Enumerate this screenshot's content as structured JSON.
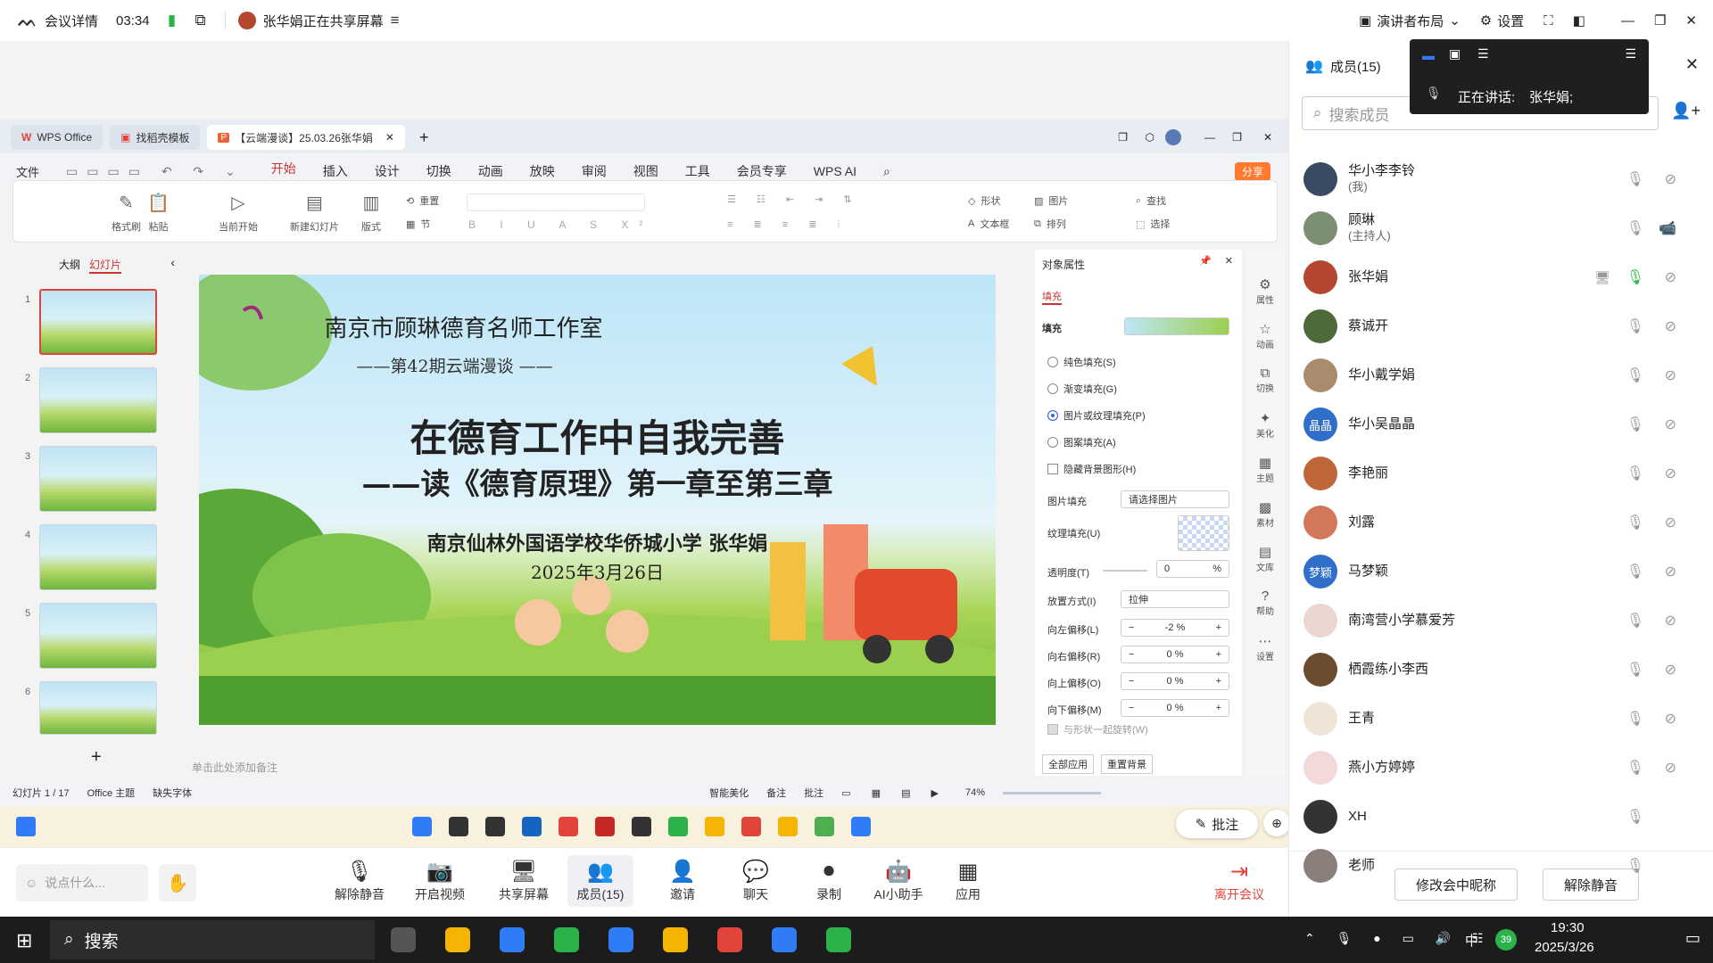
{
  "meeting": {
    "details_label": "会议详情",
    "timer": "03:34",
    "sharing_status": "张华娟正在共享屏幕",
    "layout_label": "演讲者布局",
    "settings_label": "设置"
  },
  "wps": {
    "tabs": [
      "WPS Office",
      "找稻壳模板",
      "【云端漫谈】25.03.26张华娟"
    ],
    "menu": [
      "文件",
      "开始",
      "插入",
      "设计",
      "切换",
      "动画",
      "放映",
      "审阅",
      "视图",
      "工具",
      "会员专享",
      "WPS AI"
    ],
    "share_label": "分享",
    "ribbon": {
      "format_painter": "格式刷",
      "paste": "粘贴",
      "from_start": "当前开始",
      "new_slide": "新建幻灯片",
      "layout": "版式",
      "reset": "重置",
      "section": "节",
      "shape": "形状",
      "picture": "图片",
      "textbox": "文本框",
      "arrange": "排列",
      "find": "查找",
      "select": "选择"
    },
    "pane_tabs": [
      "大纲",
      "幻灯片"
    ],
    "slide_numbers": [
      "1",
      "2",
      "3",
      "4",
      "5",
      "6"
    ],
    "notes_placeholder": "单击此处添加备注",
    "status": {
      "slide_count": "幻灯片 1 / 17",
      "theme": "Office 主题",
      "missing_font": "缺失字体",
      "smart": "智能美化",
      "notes": "备注",
      "comment": "批注",
      "zoom": "74%"
    }
  },
  "slide": {
    "studio": "南京市顾琳德育名师工作室",
    "issue": "——第42期云端漫谈 ——",
    "title": "在德育工作中自我完善",
    "subtitle": "——读《德育原理》第一章至第三章",
    "author": "南京仙林外国语学校华侨城小学 张华娟",
    "date": "2025年3月26日"
  },
  "props": {
    "title": "对象属性",
    "tab": "填充",
    "fill_section": "填充",
    "options": [
      "纯色填充(S)",
      "渐变填充(G)",
      "图片或纹理填充(P)",
      "图案填充(A)"
    ],
    "hide_bg": "隐藏背景图形(H)",
    "picture_fill_label": "图片填充",
    "picture_fill_value": "请选择图片",
    "texture_label": "纹理填充(U)",
    "transparency_label": "透明度(T)",
    "transparency_value": "0",
    "placement_label": "放置方式(I)",
    "placement_value": "拉伸",
    "offsets": [
      {
        "label": "向左偏移(L)",
        "value": "-2 %"
      },
      {
        "label": "向右偏移(R)",
        "value": "0 %"
      },
      {
        "label": "向上偏移(O)",
        "value": "0 %"
      },
      {
        "label": "向下偏移(M)",
        "value": "0 %"
      }
    ],
    "rotate_with_shape": "与形状一起旋转(W)",
    "apply_all": "全部应用",
    "reset_bg": "重置背景",
    "side_icons": [
      "属性",
      "动画",
      "切换",
      "美化",
      "主题",
      "素材",
      "文库",
      "帮助",
      "设置"
    ]
  },
  "annotate_label": "批注",
  "bottom_bar": {
    "chat_placeholder": "说点什么...",
    "buttons": [
      "解除静音",
      "开启视频",
      "共享屏幕",
      "成员(15)",
      "邀请",
      "聊天",
      "录制",
      "AI小助手",
      "应用"
    ],
    "leave": "离开会议"
  },
  "members": {
    "title": "成员(15)",
    "search_placeholder": "搜索成员",
    "speaking_label": "正在讲话:",
    "speaking_name": "张华娟;",
    "list": [
      {
        "name": "华小李李铃",
        "sub": "(我)",
        "color": "#3b4a63",
        "initials": ""
      },
      {
        "name": "顾琳",
        "sub": "(主持人)",
        "color": "#7a8f74",
        "initials": ""
      },
      {
        "name": "张华娟",
        "sub": "",
        "color": "#b5462f",
        "initials": ""
      },
      {
        "name": "蔡诚开",
        "sub": "",
        "color": "#4e6a3a",
        "initials": ""
      },
      {
        "name": "华小戴学娟",
        "sub": "",
        "color": "#a98b6d",
        "initials": ""
      },
      {
        "name": "华小吴晶晶",
        "sub": "",
        "color": "#2f6fc9",
        "initials": "晶晶"
      },
      {
        "name": "李艳丽",
        "sub": "",
        "color": "#c0673a",
        "initials": ""
      },
      {
        "name": "刘露",
        "sub": "",
        "color": "#d2785a",
        "initials": ""
      },
      {
        "name": "马梦颖",
        "sub": "",
        "color": "#2f6fc9",
        "initials": "梦颖"
      },
      {
        "name": "南湾营小学慕爱芳",
        "sub": "",
        "color": "#e8d6cf",
        "initials": ""
      },
      {
        "name": "栖霞练小李西",
        "sub": "",
        "color": "#6b4c2e",
        "initials": ""
      },
      {
        "name": "王青",
        "sub": "",
        "color": "#f0e4d6",
        "initials": ""
      },
      {
        "name": "燕小方婷婷",
        "sub": "",
        "color": "#f3d9d9",
        "initials": ""
      },
      {
        "name": "XH",
        "sub": "",
        "color": "#333333",
        "initials": ""
      },
      {
        "name": "老师",
        "sub": "",
        "color": "#8a7e7a",
        "initials": ""
      }
    ],
    "rename_button": "修改会中昵称",
    "unmute_button": "解除静音"
  },
  "windows": {
    "search_label": "搜索",
    "time": "19:30",
    "date": "2025/3/26",
    "lang": "中",
    "badge": "39"
  }
}
